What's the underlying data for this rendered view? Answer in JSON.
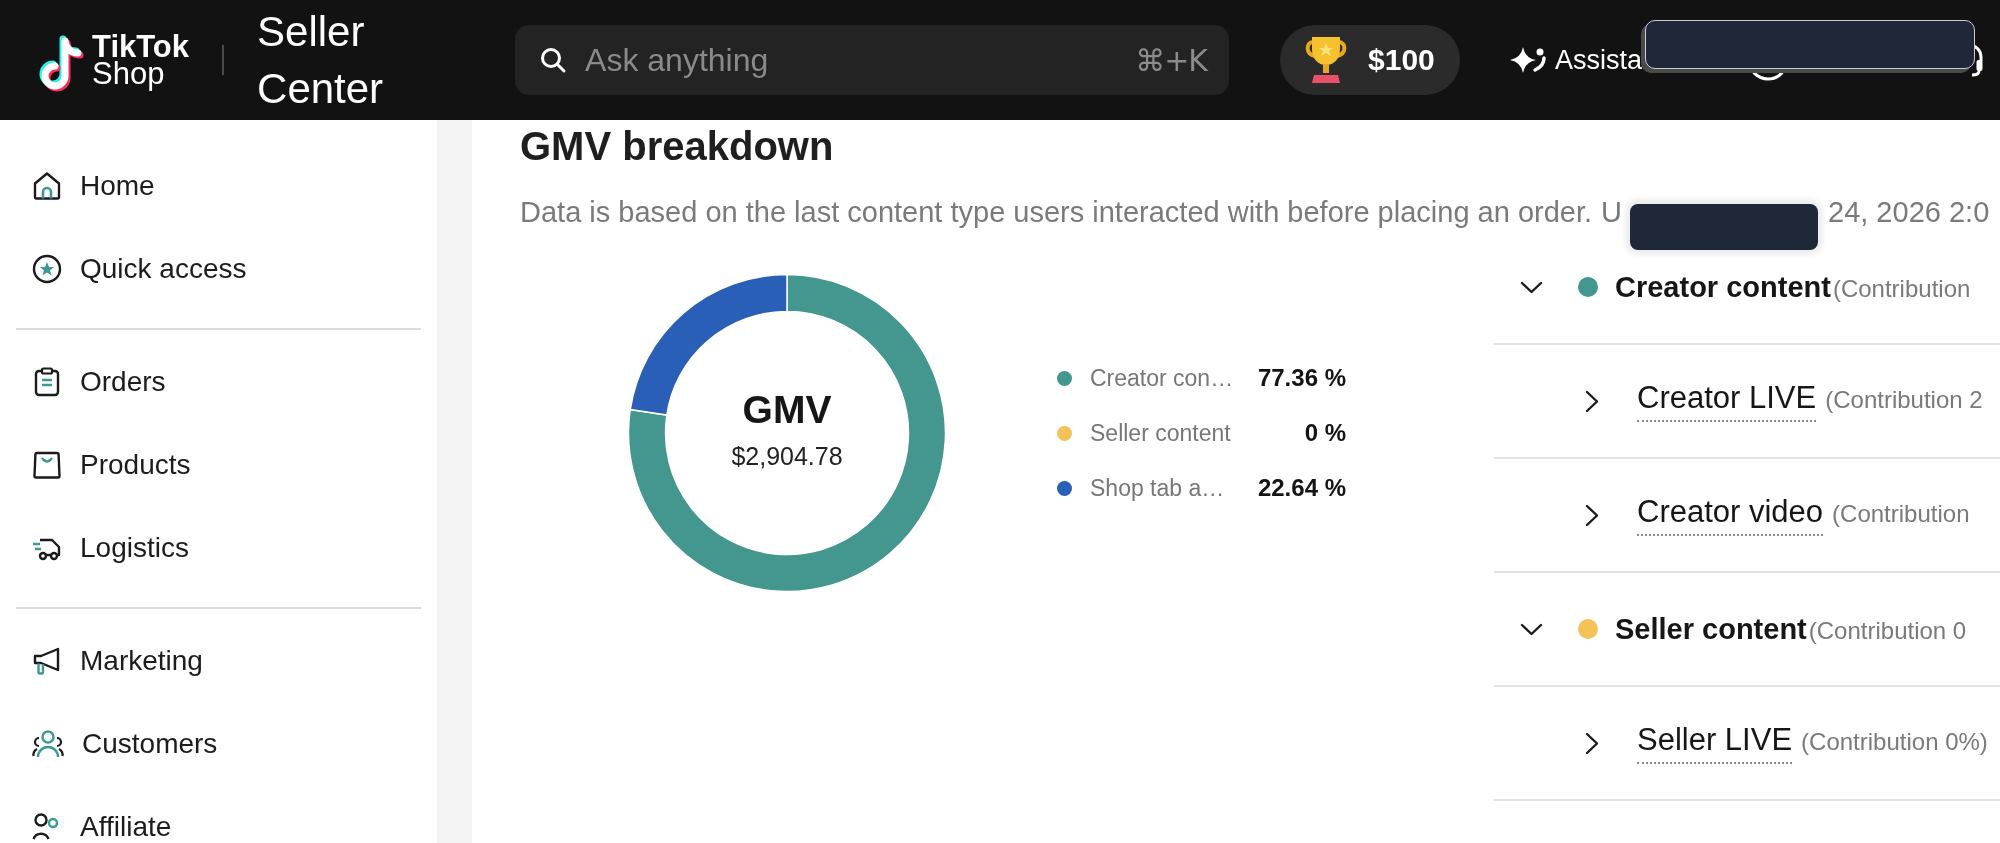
{
  "top_bar": {
    "logo": [
      "TikTok",
      "Shop"
    ],
    "app_title": "Seller Center",
    "search": {
      "placeholder": "Ask anything",
      "shortcut": "⌘+K"
    },
    "reward": {
      "amount": "$100"
    },
    "assistant": {
      "label": "Assista"
    }
  },
  "sidebar": {
    "groups": [
      {
        "items": [
          {
            "label": "Home",
            "selected": false
          },
          {
            "label": "Quick access",
            "selected": false
          }
        ]
      },
      {
        "items": [
          {
            "label": "Orders",
            "selected": false
          },
          {
            "label": "Products",
            "selected": false
          },
          {
            "label": "Logistics",
            "selected": false
          }
        ]
      },
      {
        "items": [
          {
            "label": "Marketing",
            "selected": false
          },
          {
            "label": "Customers",
            "selected": false
          },
          {
            "label": "Affiliate",
            "selected": false
          }
        ]
      }
    ]
  },
  "gmv_breakdown": {
    "title": "GMV breakdown",
    "note": "Data is based on the last content type users interacted with before placing an order.",
    "updated": [
      "U",
      "24, 2026 2:0"
    ],
    "total": "$2,904.78",
    "chart_data": {
      "type": "donut",
      "title": "GMV",
      "categories": [
        "Creator con…",
        "Seller content",
        "Shop tab a…"
      ],
      "values": [
        77.36,
        0,
        22.64
      ]
    },
    "legend": [
      {
        "value": "77.36 %",
        "color": "#43978f"
      },
      {
        "value": "0 %",
        "color": "#f3c35a"
      },
      {
        "value": "22.64 %",
        "color": "#2a5fb8"
      }
    ],
    "breakdown": [
      {
        "label": "Creator content",
        "contribution": "(Contribution",
        "color": "#43978f",
        "expanded": true,
        "children": [
          {
            "label": "Creator LIVE",
            "contribution": "(Contribution 2",
            "expanded": false
          },
          {
            "label": "Creator video",
            "contribution": "(Contribution",
            "expanded": false
          }
        ]
      },
      {
        "label": "Seller content",
        "contribution": "(Contribution 0",
        "color": "#f3c35a",
        "expanded": true,
        "children": [
          {
            "label": "Seller LIVE",
            "contribution": "(Contribution 0%)",
            "expanded": false
          }
        ]
      }
    ]
  }
}
